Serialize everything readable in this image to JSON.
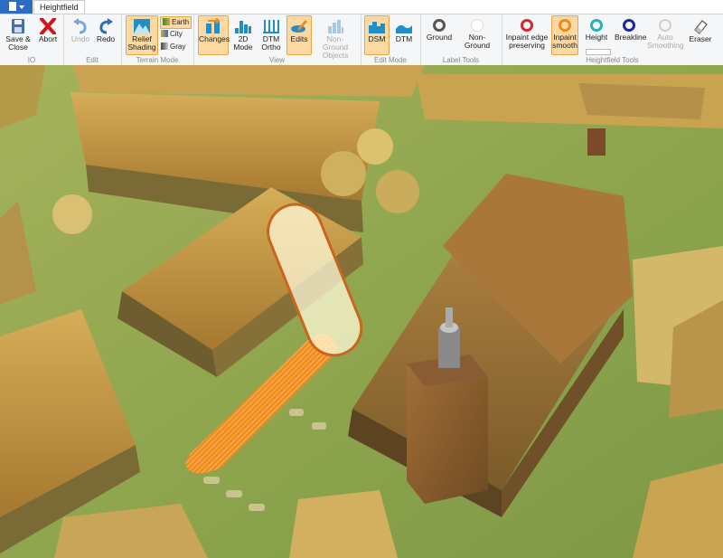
{
  "window": {
    "tab": "Heightfield"
  },
  "ribbon": {
    "io": {
      "label": "IO",
      "save": "Save &\nClose",
      "abort": "Abort"
    },
    "edit": {
      "label": "Edit",
      "undo": "Undo",
      "redo": "Redo"
    },
    "terrain": {
      "label": "Terrain Mode",
      "relief": "Relief\nShading",
      "earth": "Earth",
      "city": "City",
      "gray": "Gray"
    },
    "view": {
      "label": "View",
      "changes": "Changes",
      "mode2d": "2D\nMode",
      "dtm_ortho": "DTM\nOrtho",
      "edits": "Edits",
      "non_ground": "Non-Ground\nObjects"
    },
    "edit_mode": {
      "label": "Edit Mode",
      "dsm": "DSM",
      "dtm": "DTM"
    },
    "label_tools": {
      "label": "Label Tools",
      "ground": "Ground",
      "non_ground": "Non-Ground"
    },
    "hf_tools": {
      "label": "Heightfield Tools",
      "inpaint_edge": "Inpaint edge\npreserving",
      "inpaint_smooth": "Inpaint\nsmooth",
      "height": "Height",
      "breakline": "Breakline",
      "auto_smoothing": "Auto\nSmoothing",
      "eraser": "Eraser"
    }
  },
  "colors": {
    "accent": "#2b6cc4",
    "active_fill": "#fcd9a2",
    "active_border": "#e6a64a",
    "ground": "#555555",
    "inpaint_edge": "#d9262c",
    "inpaint_smooth": "#f08a1c",
    "height": "#23b3b3",
    "breakline": "#1a2aa0",
    "brush_stroke": "#f28a1e"
  }
}
